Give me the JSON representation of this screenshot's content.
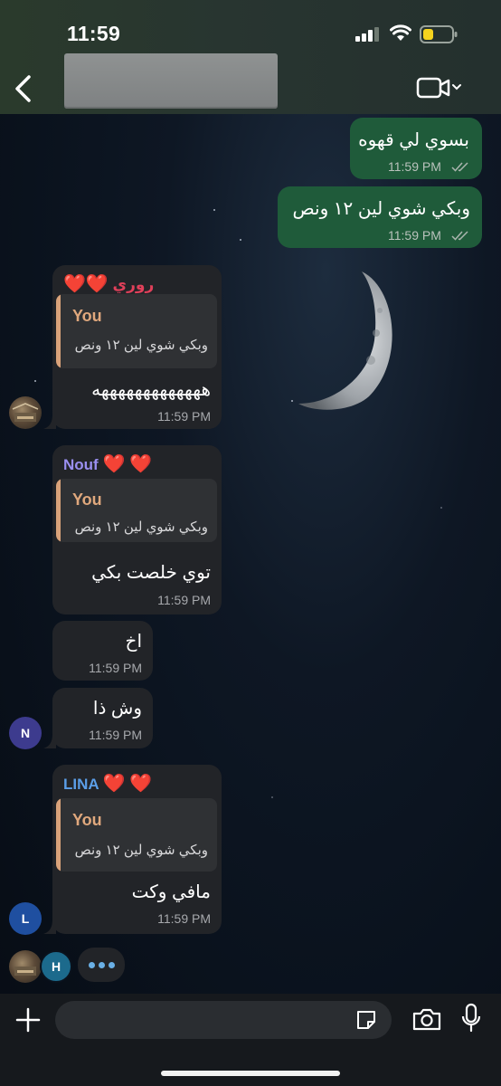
{
  "status_bar": {
    "time": "11:59"
  },
  "header": {
    "back_icon": "chevron-left-icon",
    "video_icon": "video-camera-icon"
  },
  "messages": [
    {
      "type": "outgoing",
      "text": "بسوي لي قهوه",
      "time": "11:59 PM"
    },
    {
      "type": "outgoing",
      "text": "وبكي شوي لين ١٢ ونص",
      "time": "11:59 PM"
    },
    {
      "type": "incoming",
      "sender": "روري",
      "sender_color": "#e0405a",
      "reply_author": "You",
      "reply_text": "وبكي شوي لين ١٢ ونص",
      "text": "هههههههههههههه",
      "time": "11:59 PM"
    },
    {
      "type": "incoming",
      "sender": "Nouf",
      "sender_color": "#9a8ff0",
      "reply_author": "You",
      "reply_text": "وبكي شوي لين ١٢ ونص",
      "text": "توي خلصت بكي",
      "time": "11:59 PM"
    },
    {
      "type": "incoming",
      "text": "اخ",
      "time": "11:59 PM"
    },
    {
      "type": "incoming",
      "text": "وش ذا",
      "time": "11:59 PM",
      "avatar_letter": "N",
      "avatar_color": "#3d3b8e"
    },
    {
      "type": "incoming",
      "sender": "LINA",
      "sender_color": "#5b9ee8",
      "reply_author": "You",
      "reply_text": "وبكي شوي لين ١٢ ونص",
      "text": "مافي وكت",
      "time": "11:59 PM",
      "avatar_letter": "L",
      "avatar_color": "#1f4fa0"
    }
  ],
  "typing": {
    "avatar_letter": "H",
    "avatar_color": "#1c6a8c"
  },
  "composer": {
    "placeholder": ""
  },
  "colors": {
    "outgoing_bubble": "#1f5b3a",
    "incoming_bubble": "#222428",
    "reply_bar": "#d9a27a"
  }
}
